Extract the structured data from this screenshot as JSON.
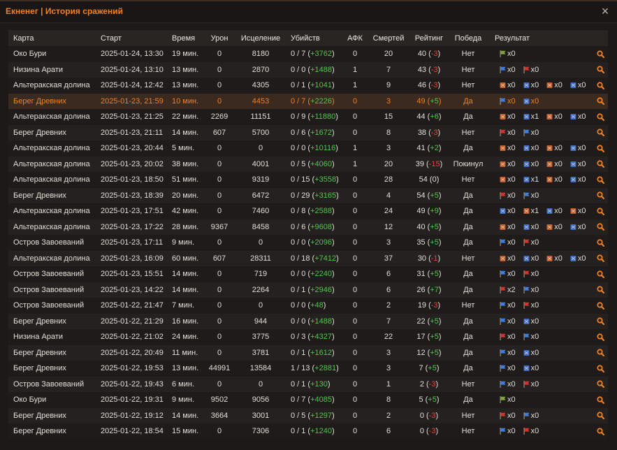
{
  "window": {
    "title": "Екненег | История сражений",
    "close_label": "×"
  },
  "colors": {
    "accent": "#f2801f",
    "positive": "#4fc84a",
    "negative": "#e2463a"
  },
  "table": {
    "columns": [
      "Карта",
      "Старт",
      "Время",
      "Урон",
      "Исцеление",
      "Убийств",
      "АФК",
      "Смертей",
      "Рейтинг",
      "Победа",
      "Результат"
    ],
    "rows": [
      {
        "map": "Око Бури",
        "start": "2025-01-24, 13:30",
        "duration": "19 мин.",
        "damage": "0",
        "healing": "8180",
        "kills": "0 / 7",
        "kills_bonus": "+3762",
        "afk": "0",
        "deaths": "20",
        "rating": "40",
        "rating_delta": "-3",
        "victory": "Нет",
        "result": [
          {
            "icon": "green-flag",
            "count": "x0"
          }
        ]
      },
      {
        "map": "Низина Арати",
        "start": "2025-01-24, 13:10",
        "duration": "13 мин.",
        "damage": "0",
        "healing": "2870",
        "kills": "0 / 0",
        "kills_bonus": "+1488",
        "afk": "1",
        "deaths": "7",
        "rating": "43",
        "rating_delta": "-3",
        "victory": "Нет",
        "result": [
          {
            "icon": "blue-flag",
            "count": "x0"
          },
          {
            "icon": "red-flag",
            "count": "x0"
          }
        ]
      },
      {
        "map": "Альтеракская долина",
        "start": "2025-01-24, 12:42",
        "duration": "13 мин.",
        "damage": "0",
        "healing": "4305",
        "kills": "0 / 1",
        "kills_bonus": "+1041",
        "afk": "1",
        "deaths": "9",
        "rating": "46",
        "rating_delta": "-3",
        "victory": "Нет",
        "result": [
          {
            "icon": "orange-banner",
            "count": "x0"
          },
          {
            "icon": "blue-banner",
            "count": "x0"
          },
          {
            "icon": "orange-banner",
            "count": "x0"
          },
          {
            "icon": "blue-banner",
            "count": "x0"
          }
        ]
      },
      {
        "map": "Берег Древних",
        "start": "2025-01-23, 21:59",
        "duration": "10 мин.",
        "damage": "0",
        "healing": "4453",
        "kills": "0 / 7",
        "kills_bonus": "+2226",
        "afk": "0",
        "deaths": "3",
        "rating": "49",
        "rating_delta": "+5",
        "victory": "Да",
        "selected": true,
        "result": [
          {
            "icon": "blue-flag",
            "count": "x0"
          },
          {
            "icon": "blue-banner",
            "count": "x0"
          }
        ]
      },
      {
        "map": "Альтеракская долина",
        "start": "2025-01-23, 21:25",
        "duration": "22 мин.",
        "damage": "2269",
        "healing": "11151",
        "kills": "0 / 9",
        "kills_bonus": "+11880",
        "afk": "0",
        "deaths": "15",
        "rating": "44",
        "rating_delta": "+6",
        "victory": "Да",
        "result": [
          {
            "icon": "orange-banner",
            "count": "x0"
          },
          {
            "icon": "blue-banner",
            "count": "x1"
          },
          {
            "icon": "orange-banner",
            "count": "x0"
          },
          {
            "icon": "blue-banner",
            "count": "x0"
          }
        ]
      },
      {
        "map": "Берег Древних",
        "start": "2025-01-23, 21:11",
        "duration": "14 мин.",
        "damage": "607",
        "healing": "5700",
        "kills": "0 / 6",
        "kills_bonus": "+1672",
        "afk": "0",
        "deaths": "8",
        "rating": "38",
        "rating_delta": "-3",
        "victory": "Нет",
        "result": [
          {
            "icon": "red-flag",
            "count": "x0"
          },
          {
            "icon": "blue-flag",
            "count": "x0"
          }
        ]
      },
      {
        "map": "Альтеракская долина",
        "start": "2025-01-23, 20:44",
        "duration": "5 мин.",
        "damage": "0",
        "healing": "0",
        "kills": "0 / 0",
        "kills_bonus": "+10116",
        "afk": "1",
        "deaths": "3",
        "rating": "41",
        "rating_delta": "+2",
        "victory": "Да",
        "result": [
          {
            "icon": "orange-banner",
            "count": "x0"
          },
          {
            "icon": "blue-banner",
            "count": "x0"
          },
          {
            "icon": "orange-banner",
            "count": "x0"
          },
          {
            "icon": "blue-banner",
            "count": "x0"
          }
        ]
      },
      {
        "map": "Альтеракская долина",
        "start": "2025-01-23, 20:02",
        "duration": "38 мин.",
        "damage": "0",
        "healing": "4001",
        "kills": "0 / 5",
        "kills_bonus": "+4060",
        "afk": "1",
        "deaths": "20",
        "rating": "39",
        "rating_delta": "-15",
        "victory": "Покинул",
        "result": [
          {
            "icon": "orange-banner",
            "count": "x0"
          },
          {
            "icon": "blue-banner",
            "count": "x0"
          },
          {
            "icon": "orange-banner",
            "count": "x0"
          },
          {
            "icon": "blue-banner",
            "count": "x0"
          }
        ]
      },
      {
        "map": "Альтеракская долина",
        "start": "2025-01-23, 18:50",
        "duration": "51 мин.",
        "damage": "0",
        "healing": "9319",
        "kills": "0 / 15",
        "kills_bonus": "+3558",
        "afk": "0",
        "deaths": "28",
        "rating": "54",
        "rating_delta": "0",
        "victory": "Нет",
        "result": [
          {
            "icon": "orange-banner",
            "count": "x0"
          },
          {
            "icon": "blue-banner",
            "count": "x1"
          },
          {
            "icon": "orange-banner",
            "count": "x0"
          },
          {
            "icon": "blue-banner",
            "count": "x0"
          }
        ]
      },
      {
        "map": "Берег Древних",
        "start": "2025-01-23, 18:39",
        "duration": "20 мин.",
        "damage": "0",
        "healing": "6472",
        "kills": "0 / 29",
        "kills_bonus": "+3165",
        "afk": "0",
        "deaths": "4",
        "rating": "54",
        "rating_delta": "+5",
        "victory": "Да",
        "result": [
          {
            "icon": "red-flag",
            "count": "x0"
          },
          {
            "icon": "blue-flag",
            "count": "x0"
          }
        ]
      },
      {
        "map": "Альтеракская долина",
        "start": "2025-01-23, 17:51",
        "duration": "42 мин.",
        "damage": "0",
        "healing": "7460",
        "kills": "0 / 8",
        "kills_bonus": "+2588",
        "afk": "0",
        "deaths": "24",
        "rating": "49",
        "rating_delta": "+9",
        "victory": "Да",
        "result": [
          {
            "icon": "blue-banner",
            "count": "x0"
          },
          {
            "icon": "orange-banner",
            "count": "x1"
          },
          {
            "icon": "blue-banner",
            "count": "x0"
          },
          {
            "icon": "orange-banner",
            "count": "x0"
          }
        ]
      },
      {
        "map": "Альтеракская долина",
        "start": "2025-01-23, 17:22",
        "duration": "28 мин.",
        "damage": "9367",
        "healing": "8458",
        "kills": "0 / 6",
        "kills_bonus": "+9608",
        "afk": "0",
        "deaths": "12",
        "rating": "40",
        "rating_delta": "+5",
        "victory": "Да",
        "result": [
          {
            "icon": "orange-banner",
            "count": "x0"
          },
          {
            "icon": "blue-banner",
            "count": "x0"
          },
          {
            "icon": "orange-banner",
            "count": "x0"
          },
          {
            "icon": "blue-banner",
            "count": "x0"
          }
        ]
      },
      {
        "map": "Остров Завоеваний",
        "start": "2025-01-23, 17:11",
        "duration": "9 мин.",
        "damage": "0",
        "healing": "0",
        "kills": "0 / 0",
        "kills_bonus": "+2096",
        "afk": "0",
        "deaths": "3",
        "rating": "35",
        "rating_delta": "+5",
        "victory": "Да",
        "result": [
          {
            "icon": "blue-flag",
            "count": "x0"
          },
          {
            "icon": "red-flag",
            "count": "x0"
          }
        ]
      },
      {
        "map": "Альтеракская долина",
        "start": "2025-01-23, 16:09",
        "duration": "60 мин.",
        "damage": "607",
        "healing": "28311",
        "kills": "0 / 18",
        "kills_bonus": "+7412",
        "afk": "0",
        "deaths": "37",
        "rating": "30",
        "rating_delta": "-1",
        "victory": "Нет",
        "result": [
          {
            "icon": "orange-banner",
            "count": "x0"
          },
          {
            "icon": "blue-banner",
            "count": "x0"
          },
          {
            "icon": "orange-banner",
            "count": "x0"
          },
          {
            "icon": "blue-banner",
            "count": "x0"
          }
        ]
      },
      {
        "map": "Остров Завоеваний",
        "start": "2025-01-23, 15:51",
        "duration": "14 мин.",
        "damage": "0",
        "healing": "719",
        "kills": "0 / 0",
        "kills_bonus": "+2240",
        "afk": "0",
        "deaths": "6",
        "rating": "31",
        "rating_delta": "+5",
        "victory": "Да",
        "result": [
          {
            "icon": "blue-flag",
            "count": "x0"
          },
          {
            "icon": "red-flag",
            "count": "x0"
          }
        ]
      },
      {
        "map": "Остров Завоеваний",
        "start": "2025-01-23, 14:22",
        "duration": "14 мин.",
        "damage": "0",
        "healing": "2264",
        "kills": "0 / 1",
        "kills_bonus": "+2946",
        "afk": "0",
        "deaths": "6",
        "rating": "26",
        "rating_delta": "+7",
        "victory": "Да",
        "result": [
          {
            "icon": "red-flag",
            "count": "x2"
          },
          {
            "icon": "blue-flag",
            "count": "x0"
          }
        ]
      },
      {
        "map": "Остров Завоеваний",
        "start": "2025-01-22, 21:47",
        "duration": "7 мин.",
        "damage": "0",
        "healing": "0",
        "kills": "0 / 0",
        "kills_bonus": "+48",
        "afk": "0",
        "deaths": "2",
        "rating": "19",
        "rating_delta": "-3",
        "victory": "Нет",
        "result": [
          {
            "icon": "blue-flag",
            "count": "x0"
          },
          {
            "icon": "red-flag",
            "count": "x0"
          }
        ]
      },
      {
        "map": "Берег Древних",
        "start": "2025-01-22, 21:29",
        "duration": "16 мин.",
        "damage": "0",
        "healing": "944",
        "kills": "0 / 0",
        "kills_bonus": "+1488",
        "afk": "0",
        "deaths": "7",
        "rating": "22",
        "rating_delta": "+5",
        "victory": "Да",
        "result": [
          {
            "icon": "blue-flag",
            "count": "x0"
          },
          {
            "icon": "blue-banner",
            "count": "x0"
          }
        ]
      },
      {
        "map": "Низина Арати",
        "start": "2025-01-22, 21:02",
        "duration": "24 мин.",
        "damage": "0",
        "healing": "3775",
        "kills": "0 / 3",
        "kills_bonus": "+4327",
        "afk": "0",
        "deaths": "22",
        "rating": "17",
        "rating_delta": "+5",
        "victory": "Да",
        "result": [
          {
            "icon": "red-flag",
            "count": "x0"
          },
          {
            "icon": "blue-flag",
            "count": "x0"
          }
        ]
      },
      {
        "map": "Берег Древних",
        "start": "2025-01-22, 20:49",
        "duration": "11 мин.",
        "damage": "0",
        "healing": "3781",
        "kills": "0 / 1",
        "kills_bonus": "+1612",
        "afk": "0",
        "deaths": "3",
        "rating": "12",
        "rating_delta": "+5",
        "victory": "Да",
        "result": [
          {
            "icon": "blue-flag",
            "count": "x0"
          },
          {
            "icon": "blue-banner",
            "count": "x0"
          }
        ]
      },
      {
        "map": "Берег Древних",
        "start": "2025-01-22, 19:53",
        "duration": "13 мин.",
        "damage": "44991",
        "healing": "13584",
        "kills": "1 / 13",
        "kills_bonus": "+2881",
        "afk": "0",
        "deaths": "3",
        "rating": "7",
        "rating_delta": "+5",
        "victory": "Да",
        "result": [
          {
            "icon": "blue-flag",
            "count": "x0"
          },
          {
            "icon": "blue-banner",
            "count": "x0"
          }
        ]
      },
      {
        "map": "Остров Завоеваний",
        "start": "2025-01-22, 19:43",
        "duration": "6 мин.",
        "damage": "0",
        "healing": "0",
        "kills": "0 / 1",
        "kills_bonus": "+130",
        "afk": "0",
        "deaths": "1",
        "rating": "2",
        "rating_delta": "-3",
        "victory": "Нет",
        "result": [
          {
            "icon": "blue-flag",
            "count": "x0"
          },
          {
            "icon": "red-flag",
            "count": "x0"
          }
        ]
      },
      {
        "map": "Око Бури",
        "start": "2025-01-22, 19:31",
        "duration": "9 мин.",
        "damage": "9502",
        "healing": "9056",
        "kills": "0 / 7",
        "kills_bonus": "+4085",
        "afk": "0",
        "deaths": "8",
        "rating": "5",
        "rating_delta": "+5",
        "victory": "Да",
        "result": [
          {
            "icon": "green-flag",
            "count": "x0"
          }
        ]
      },
      {
        "map": "Берег Древних",
        "start": "2025-01-22, 19:12",
        "duration": "14 мин.",
        "damage": "3664",
        "healing": "3001",
        "kills": "0 / 5",
        "kills_bonus": "+1297",
        "afk": "0",
        "deaths": "2",
        "rating": "0",
        "rating_delta": "-3",
        "victory": "Нет",
        "result": [
          {
            "icon": "red-flag",
            "count": "x0"
          },
          {
            "icon": "blue-flag",
            "count": "x0"
          }
        ]
      },
      {
        "map": "Берег Древних",
        "start": "2025-01-22, 18:54",
        "duration": "15 мин.",
        "damage": "0",
        "healing": "7306",
        "kills": "0 / 1",
        "kills_bonus": "+1240",
        "afk": "0",
        "deaths": "6",
        "rating": "0",
        "rating_delta": "-3",
        "victory": "Нет",
        "result": [
          {
            "icon": "blue-flag",
            "count": "x0"
          },
          {
            "icon": "red-flag",
            "count": "x0"
          }
        ]
      }
    ]
  }
}
